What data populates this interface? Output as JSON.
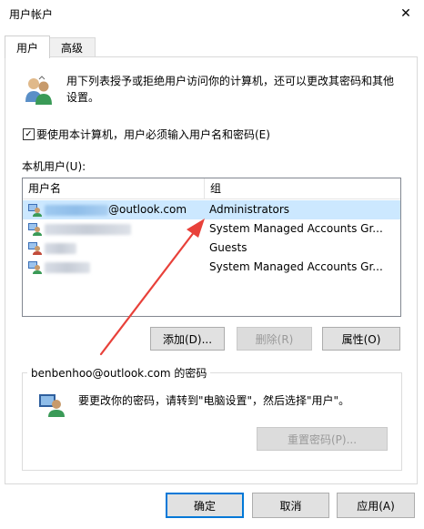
{
  "window": {
    "title": "用户帐户",
    "close_glyph": "✕"
  },
  "tabs": [
    {
      "label": "用户",
      "active": true
    },
    {
      "label": "高级",
      "active": false
    }
  ],
  "intro_text": "用下列表授予或拒绝用户访问你的计算机，还可以更改其密码和其他设置。",
  "require_password": {
    "label": "要使用本计算机，用户必须输入用户名和密码(E)",
    "checked": true,
    "check_glyph": "✓"
  },
  "users_section_label": "本机用户(U):",
  "user_list": {
    "columns": [
      "用户名",
      "组"
    ],
    "rows": [
      {
        "name_suffix": "@outlook.com",
        "group": "Administrators",
        "selected": true
      },
      {
        "name_suffix": "",
        "group": "System Managed Accounts Gr...",
        "selected": false
      },
      {
        "name_suffix": "",
        "group": "Guests",
        "selected": false
      },
      {
        "name_suffix": "",
        "group": "System Managed Accounts Gr...",
        "selected": false
      }
    ]
  },
  "list_buttons": {
    "add": "添加(D)...",
    "remove": "删除(R)",
    "properties": "属性(O)"
  },
  "password_group": {
    "title": "benbenhoo@outlook.com 的密码",
    "text": "要更改你的密码，请转到\"电脑设置\"，然后选择\"用户\"。",
    "reset_button": "重置密码(P)..."
  },
  "dialog_buttons": {
    "ok": "确定",
    "cancel": "取消",
    "apply": "应用(A)"
  },
  "colors": {
    "selection": "#cce8ff",
    "annotation_arrow": "#e8413a",
    "default_button_border": "#0078d7"
  }
}
